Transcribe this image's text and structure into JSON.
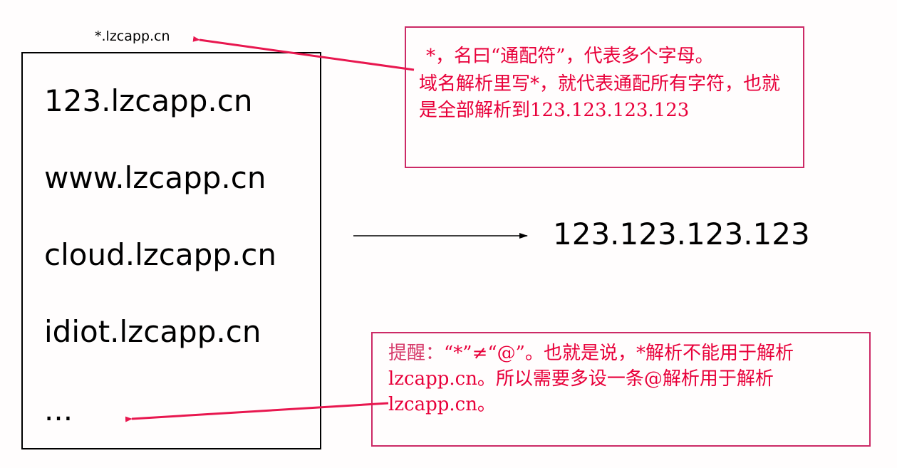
{
  "wildcard_label": "*.lzcapp.cn",
  "domains": [
    "123.lzcapp.cn",
    "www.lzcapp.cn",
    "cloud.lzcapp.cn",
    "idiot.lzcapp.cn",
    "..."
  ],
  "target_ip": "123.123.123.123",
  "note_top": {
    "line1": "*，名曰“通配符”，代表多个字母。",
    "line2": "域名解析里写*，就代表通配所有字符，也就是全部解析到123.123.123.123"
  },
  "note_bottom": {
    "prefix": "提醒：",
    "text": "“*”≠“@”。也就是说，*解析不能用于解析lzcapp.cn。所以需要多设一条@解析用于解析lzcapp.cn。"
  },
  "colors": {
    "note_text": "#e8003a",
    "note_border": "#cc2a66",
    "arrow_red": "#e8174f",
    "arrow_black": "#000000"
  }
}
